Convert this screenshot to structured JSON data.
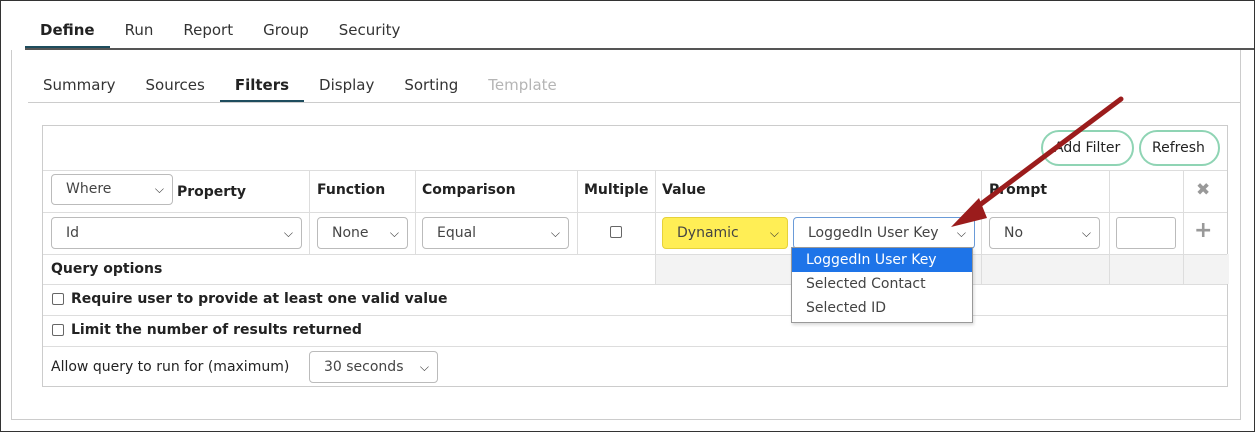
{
  "main_tabs": [
    "Define",
    "Run",
    "Report",
    "Group",
    "Security"
  ],
  "sub_tabs": [
    "Summary",
    "Sources",
    "Filters",
    "Display",
    "Sorting",
    "Template"
  ],
  "toolbar": {
    "add_filter": "Add Filter",
    "refresh": "Refresh"
  },
  "columns": {
    "property": "Property",
    "function": "Function",
    "comparison": "Comparison",
    "multiple": "Multiple",
    "value": "Value",
    "prompt": "Prompt"
  },
  "where_select": "Where",
  "filter_row": {
    "property": "Id",
    "function": "None",
    "comparison": "Equal",
    "value_mode": "Dynamic",
    "value": "LoggedIn User Key",
    "prompt": "No"
  },
  "value_options": [
    "LoggedIn User Key",
    "Selected Contact",
    "Selected ID"
  ],
  "query_options": {
    "title": "Query options",
    "require_valid": "Require user to provide at least one valid value",
    "limit_results": "Limit the number of results returned",
    "run_time_label": "Allow query to run for (maximum)",
    "run_time_value": "30 seconds"
  },
  "colors": {
    "accent": "#1e4d5e",
    "highlight": "#ffee55",
    "arrow": "#9b1c1c",
    "selected": "#1e74e8"
  }
}
